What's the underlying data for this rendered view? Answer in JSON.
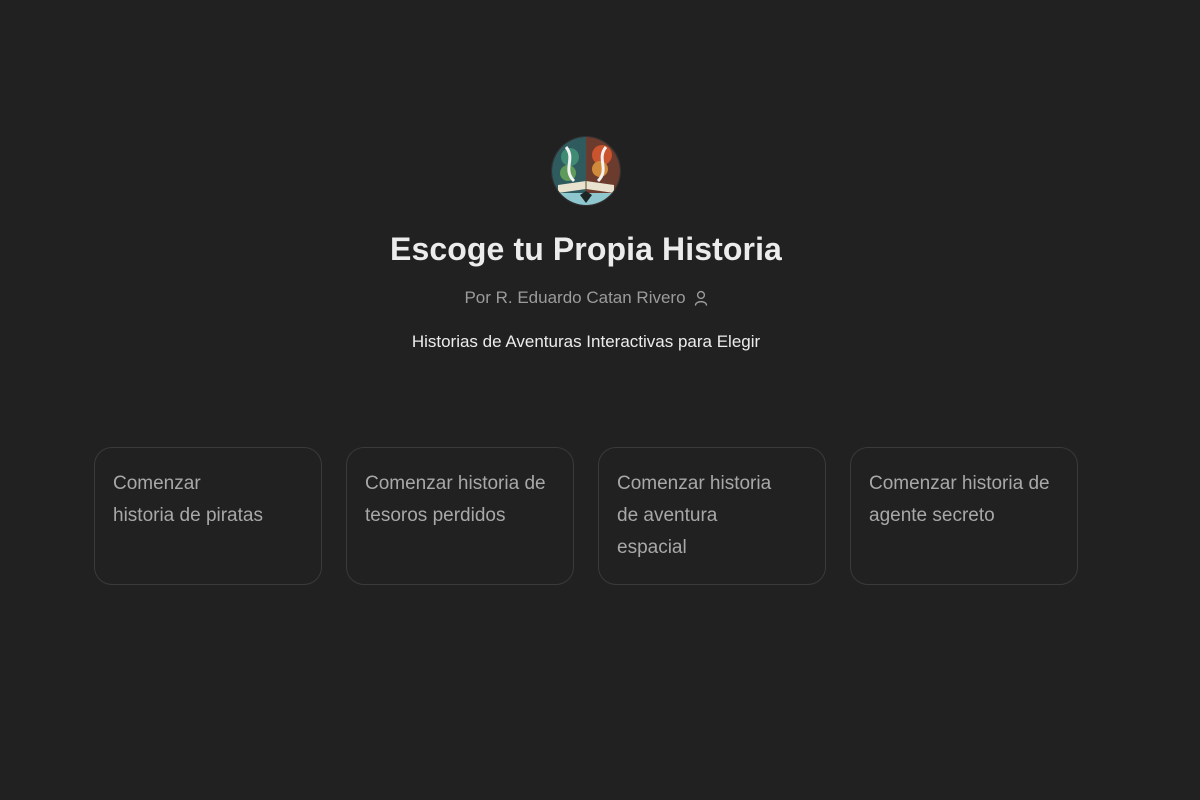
{
  "gpt": {
    "avatar_icon": "book-with-paths-icon",
    "title": "Escoge tu Propia Historia",
    "author": "Por R. Eduardo Catan Rivero",
    "author_icon": "user-icon",
    "description": "Historias de Aventuras Interactivas para Elegir"
  },
  "starters": [
    {
      "label": "Comenzar historia de piratas"
    },
    {
      "label": "Comenzar historia de tesoros perdidos"
    },
    {
      "label": "Comenzar historia de aventura espacial"
    },
    {
      "label": "Comenzar historia de agente secreto"
    }
  ],
  "colors": {
    "background": "#212121",
    "title": "#ececec",
    "muted": "#9b9b9b",
    "card_border": "#3a3a3a"
  }
}
